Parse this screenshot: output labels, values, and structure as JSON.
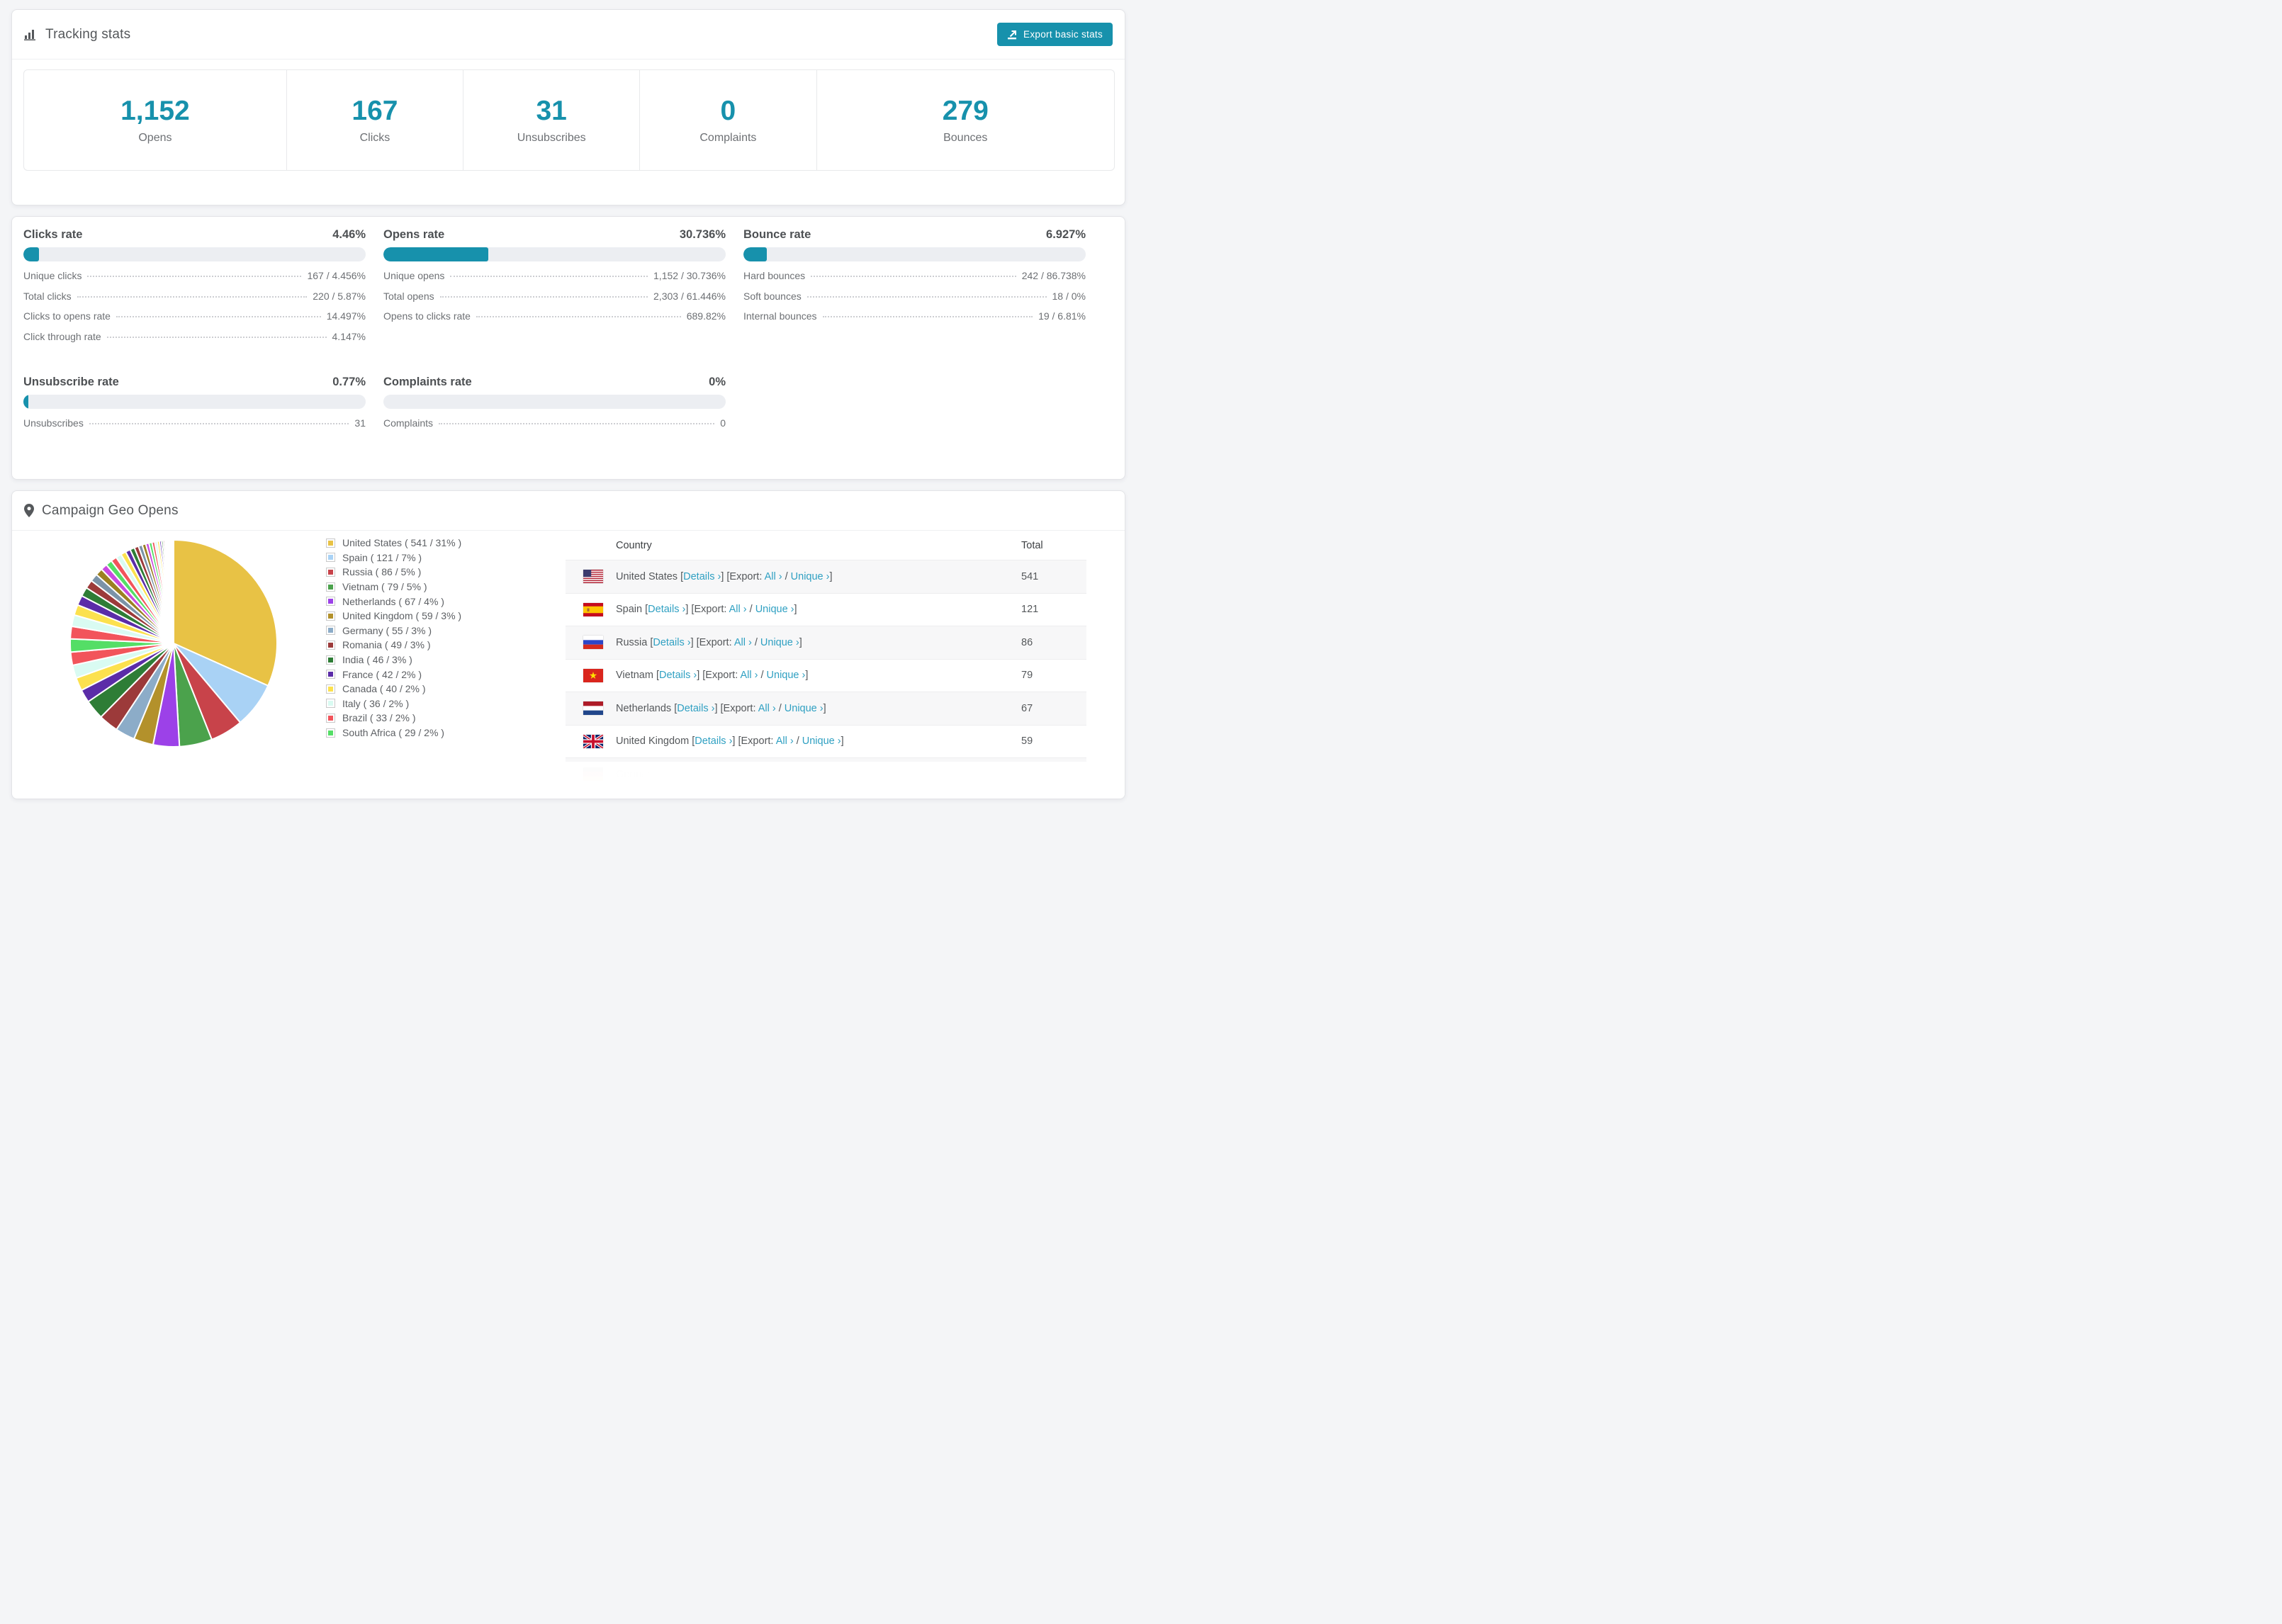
{
  "colors": {
    "accent_teal": "#1791ac",
    "link_teal": "#2fa0c2",
    "bar_track": "#eceef2"
  },
  "tracking": {
    "title": "Tracking stats",
    "export_button": "Export basic stats",
    "stats": [
      {
        "value": "1,152",
        "label": "Opens"
      },
      {
        "value": "167",
        "label": "Clicks"
      },
      {
        "value": "31",
        "label": "Unsubscribes"
      },
      {
        "value": "0",
        "label": "Complaints"
      },
      {
        "value": "279",
        "label": "Bounces"
      }
    ]
  },
  "rates": {
    "sections": [
      {
        "id": "clicks",
        "title": "Clicks rate",
        "value": "4.46%",
        "fill_pct": 4.46,
        "rows": [
          {
            "label": "Unique clicks",
            "value": "167 / 4.456%"
          },
          {
            "label": "Total clicks",
            "value": "220 / 5.87%"
          },
          {
            "label": "Clicks to opens rate",
            "value": "14.497%"
          },
          {
            "label": "Click through rate",
            "value": "4.147%"
          }
        ]
      },
      {
        "id": "opens",
        "title": "Opens rate",
        "value": "30.736%",
        "fill_pct": 30.736,
        "rows": [
          {
            "label": "Unique opens",
            "value": "1,152 / 30.736%"
          },
          {
            "label": "Total opens",
            "value": "2,303 / 61.446%"
          },
          {
            "label": "Opens to clicks rate",
            "value": "689.82%"
          }
        ]
      },
      {
        "id": "bounce",
        "title": "Bounce rate",
        "value": "6.927%",
        "fill_pct": 6.927,
        "rows": [
          {
            "label": "Hard bounces",
            "value": "242 / 86.738%"
          },
          {
            "label": "Soft bounces",
            "value": "18 / 0%"
          },
          {
            "label": "Internal bounces",
            "value": "19 / 6.81%"
          }
        ]
      },
      {
        "id": "unsubscribe",
        "title": "Unsubscribe rate",
        "value": "0.77%",
        "fill_pct": 0.77,
        "rows": [
          {
            "label": "Unsubscribes",
            "value": "31"
          }
        ]
      },
      {
        "id": "complaints",
        "title": "Complaints rate",
        "value": "0%",
        "fill_pct": 0,
        "rows": [
          {
            "label": "Complaints",
            "value": "0"
          }
        ]
      }
    ]
  },
  "geo": {
    "title": "Campaign Geo Opens",
    "table_headers": {
      "country": "Country",
      "total": "Total"
    },
    "link_labels": {
      "details": "Details ›",
      "export": "Export:",
      "all": "All ›",
      "unique": "Unique ›"
    },
    "countries": [
      {
        "name": "United States",
        "count": 541,
        "pct": 31,
        "color": "#e8c245",
        "flag": "us"
      },
      {
        "name": "Spain",
        "count": 121,
        "pct": 7,
        "color": "#a9d2f5",
        "flag": "es"
      },
      {
        "name": "Russia",
        "count": 86,
        "pct": 5,
        "color": "#c8434a",
        "flag": "ru"
      },
      {
        "name": "Vietnam",
        "count": 79,
        "pct": 5,
        "color": "#4ba24c",
        "flag": "vn"
      },
      {
        "name": "Netherlands",
        "count": 67,
        "pct": 4,
        "color": "#9c41e8",
        "flag": "nl"
      },
      {
        "name": "United Kingdom",
        "count": 59,
        "pct": 3,
        "color": "#b3912b",
        "flag": "gb"
      },
      {
        "name": "Germany",
        "count": 55,
        "pct": 3,
        "color": "#8cacc8",
        "flag": "de"
      },
      {
        "name": "Romania",
        "count": 49,
        "pct": 3,
        "color": "#9c3a3a",
        "flag": "ro"
      },
      {
        "name": "India",
        "count": 46,
        "pct": 3,
        "color": "#2e7d36",
        "flag": "in"
      },
      {
        "name": "France",
        "count": 42,
        "pct": 2,
        "color": "#5b2ca8",
        "flag": "fr"
      },
      {
        "name": "Canada",
        "count": 40,
        "pct": 2,
        "color": "#fce14e",
        "flag": "ca"
      },
      {
        "name": "Italy",
        "count": 36,
        "pct": 2,
        "color": "#d9fbf2",
        "flag": "it"
      },
      {
        "name": "Brazil",
        "count": 33,
        "pct": 2,
        "color": "#f2545b",
        "flag": "br"
      },
      {
        "name": "South Africa",
        "count": 29,
        "pct": 2,
        "color": "#54de66",
        "flag": "za"
      }
    ],
    "visible_table_rows": 7,
    "chart_data": {
      "type": "pie",
      "title": "Campaign Geo Opens",
      "legend_position": "right",
      "start_angle_deg": 0,
      "direction": "clockwise",
      "slices": [
        {
          "label": "United States",
          "value": 541,
          "pct": 31,
          "color": "#e8c245"
        },
        {
          "label": "Spain",
          "value": 121,
          "pct": 7,
          "color": "#a9d2f5"
        },
        {
          "label": "Russia",
          "value": 86,
          "pct": 5,
          "color": "#c8434a"
        },
        {
          "label": "Vietnam",
          "value": 79,
          "pct": 5,
          "color": "#4ba24c"
        },
        {
          "label": "Netherlands",
          "value": 67,
          "pct": 4,
          "color": "#9c41e8"
        },
        {
          "label": "United Kingdom",
          "value": 59,
          "pct": 3,
          "color": "#b3912b"
        },
        {
          "label": "Germany",
          "value": 55,
          "pct": 3,
          "color": "#8cacc8"
        },
        {
          "label": "Romania",
          "value": 49,
          "pct": 3,
          "color": "#9c3a3a"
        },
        {
          "label": "India",
          "value": 46,
          "pct": 3,
          "color": "#2e7d36"
        },
        {
          "label": "France",
          "value": 42,
          "pct": 2,
          "color": "#5b2ca8"
        },
        {
          "label": "Canada",
          "value": 40,
          "pct": 2,
          "color": "#fce14e"
        },
        {
          "label": "Italy",
          "value": 36,
          "pct": 2,
          "color": "#d9fbf2"
        },
        {
          "label": "Brazil",
          "value": 33,
          "pct": 2,
          "color": "#f2545b"
        },
        {
          "label": "South Africa",
          "value": 29,
          "pct": 2,
          "color": "#54de66"
        }
      ],
      "others_pct": [
        1.9,
        1.75,
        1.6,
        1.5,
        1.4,
        1.3,
        1.2,
        1.1,
        1.0,
        0.95,
        0.9,
        0.85,
        0.8,
        0.75,
        0.7,
        0.65,
        0.6,
        0.55,
        0.5,
        0.46,
        0.42,
        0.38,
        0.34,
        0.3,
        0.27,
        0.24,
        0.21,
        0.18,
        0.16,
        0.14,
        0.12,
        0.1,
        0.09,
        0.08,
        0.07,
        0.06,
        0.05,
        0.04,
        0.03,
        0.02
      ],
      "others_palette": [
        "#f2545b",
        "#d9fbf2",
        "#fce14e",
        "#5b2ca8",
        "#2e7d36",
        "#9c3a3a",
        "#7b93a8",
        "#9c8022",
        "#c94ae0",
        "#54de66"
      ]
    }
  }
}
